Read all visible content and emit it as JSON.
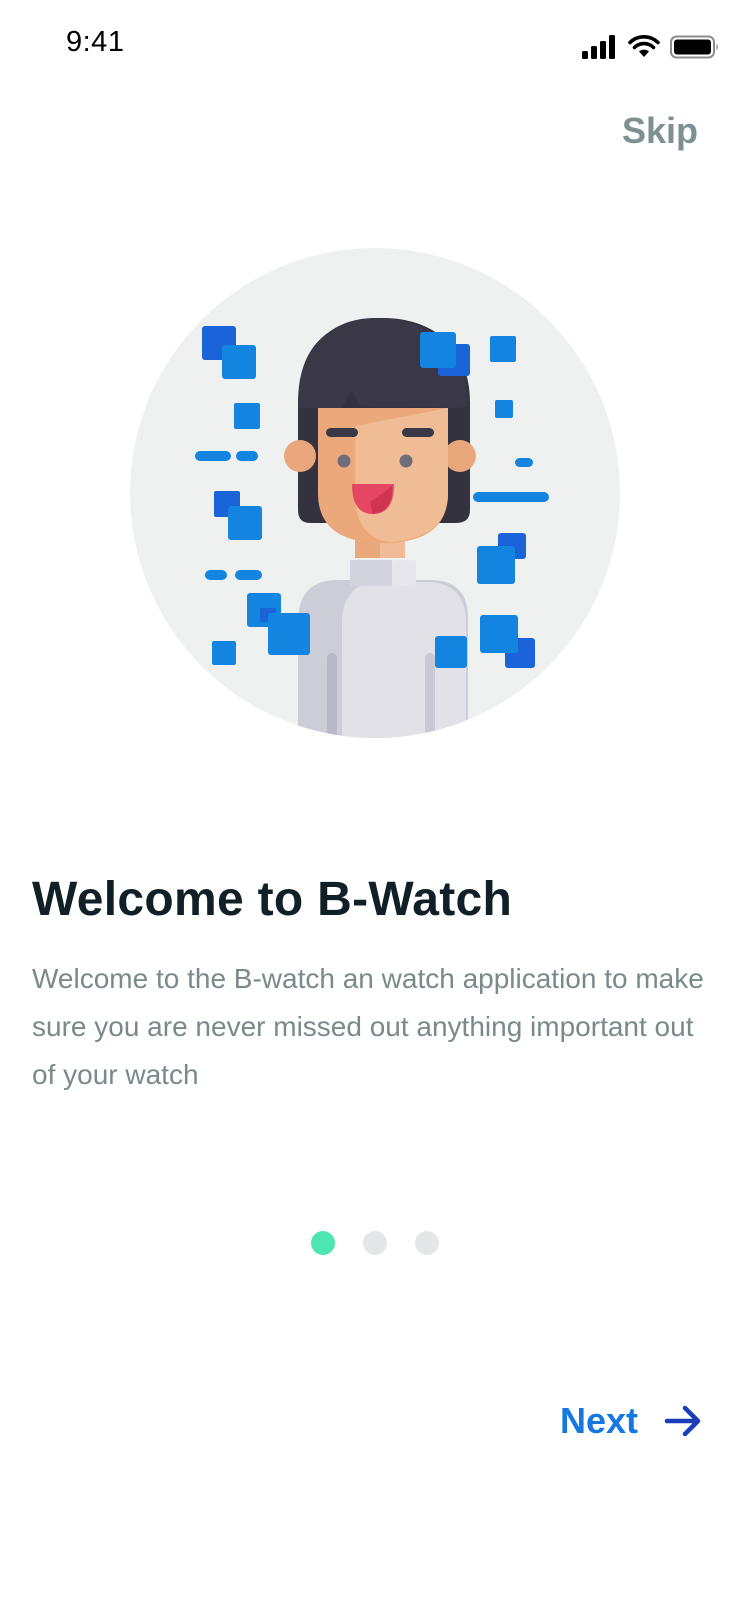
{
  "status_bar": {
    "time": "9:41",
    "icons": [
      "signal-icon",
      "wifi-icon",
      "battery-icon"
    ]
  },
  "header": {
    "skip_label": "Skip"
  },
  "onboarding": {
    "title": "Welcome to B-Watch",
    "description": "Welcome to the B-watch an watch application to make sure you are never missed out anything important out of your watch",
    "illustration": "person-avatar-illustration",
    "pager": {
      "total": 3,
      "active_index": 0
    }
  },
  "footer": {
    "next_label": "Next",
    "next_icon": "arrow-right-icon"
  },
  "colors": {
    "accent": "#1577E0",
    "arrow": "#1A3DB8",
    "pager_active": "#4DE5B0",
    "pager_inactive": "#E4E6E7",
    "title": "#102026",
    "muted_text": "#7A8A8B"
  }
}
